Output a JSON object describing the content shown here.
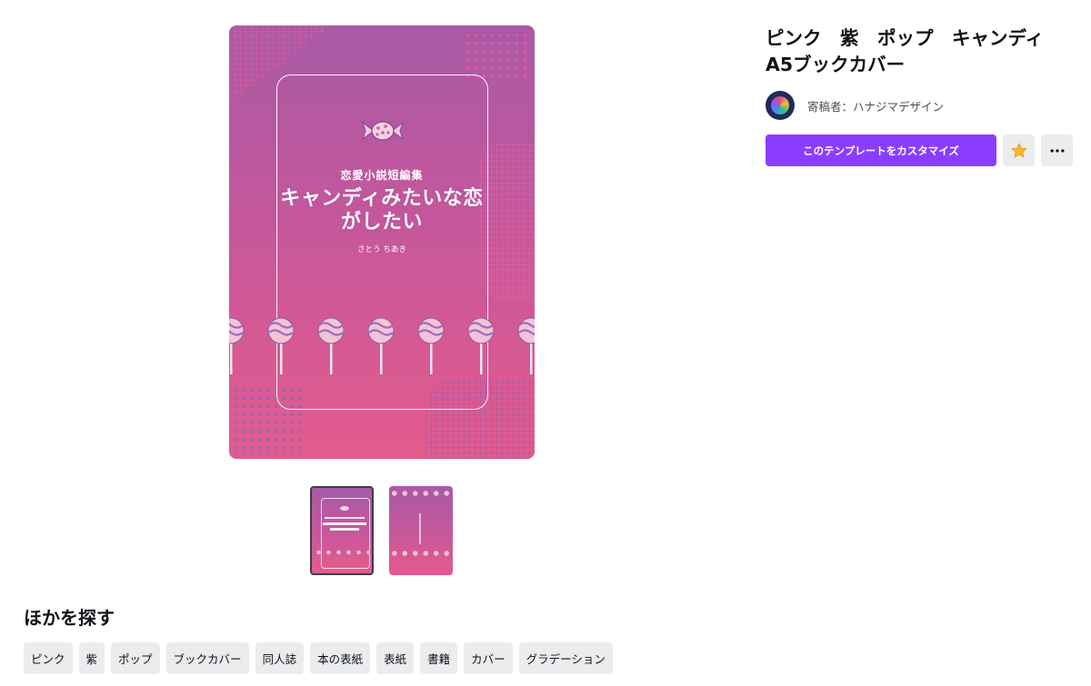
{
  "cover": {
    "subtitle": "恋愛小説短編集",
    "title": "キャンディみたいな恋がしたい",
    "author": "さとう ちあき"
  },
  "thumbnails": [
    {
      "name": "page-1",
      "selected": true
    },
    {
      "name": "page-2",
      "selected": false
    }
  ],
  "product": {
    "title": "ピンク　紫　ポップ　キャンディ\nA5ブックカバー",
    "author_label": "寄稿者：ハナジマデザイン",
    "customize_label": "このテンプレートをカスタマイズ",
    "star_icon": "star-icon",
    "more_icon": "more-icon"
  },
  "explore": {
    "heading": "ほかを探す",
    "tags": [
      "ピンク",
      "紫",
      "ポップ",
      "ブックカバー",
      "同人誌",
      "本の表紙",
      "表紙",
      "書籍",
      "カバー",
      "グラデーション"
    ]
  },
  "colors": {
    "accent": "#8b3dff",
    "cover_top": "#a85aa6",
    "cover_bottom": "#e45b8d",
    "star": "#f7b731"
  }
}
